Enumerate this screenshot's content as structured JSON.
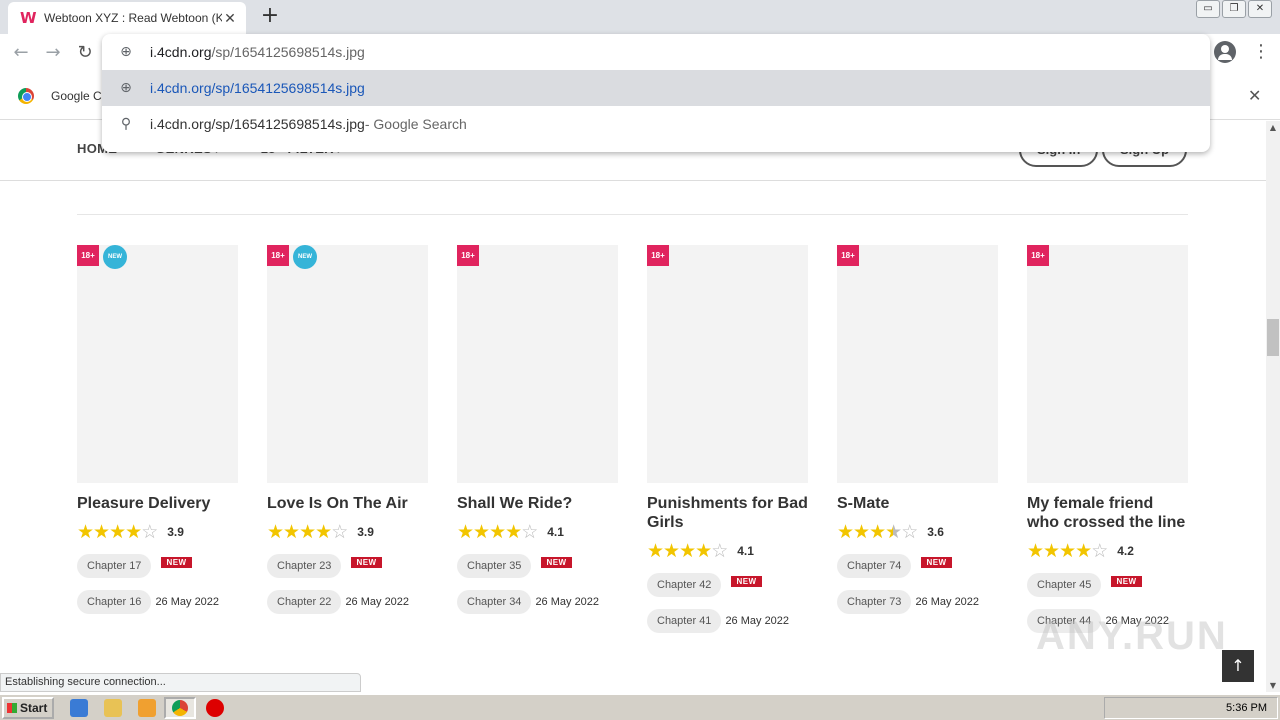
{
  "browser": {
    "tab_title": "Webtoon XYZ : Read Webtoon (Kore",
    "tab_favicon": "W",
    "tab_close": "✕",
    "new_tab": "+",
    "back_icon": "←",
    "forward_icon": "→",
    "reload_icon": "↻",
    "window_buttons": [
      "▭",
      "❐",
      "✕"
    ],
    "menu_icon": "⋮",
    "bookmark_label": "Google Chrome",
    "bookmark_close": "✕"
  },
  "omnibox": {
    "input_host": "i.4cdn.org",
    "input_path": "/sp/1654125698514s.jpg",
    "selected_suggestion": "i.4cdn.org/sp/1654125698514s.jpg",
    "search_suggestion": "i.4cdn.org/sp/1654125698514s.jpg",
    "search_suffix": " - Google Search"
  },
  "site": {
    "nav": [
      "HOME",
      "GENRES ▸",
      "18+ FILTER ▸"
    ],
    "sign_in": "Sign In",
    "sign_up": "Sign Up"
  },
  "cards": [
    {
      "title": "Pleasure Delivery",
      "stars": 3.9,
      "rating": "3.9",
      "new_badge": "NEW",
      "chapters": [
        {
          "label": "Chapter 17",
          "extra": "NEW"
        },
        {
          "label": "Chapter 16",
          "extra": "26 May 2022"
        }
      ]
    },
    {
      "title": "Love Is On The Air",
      "stars": 3.9,
      "rating": "3.9",
      "new_badge": "NEW",
      "chapters": [
        {
          "label": "Chapter 23",
          "extra": "NEW"
        },
        {
          "label": "Chapter 22",
          "extra": "26 May 2022"
        }
      ]
    },
    {
      "title": "Shall We Ride?",
      "stars": 4.1,
      "rating": "4.1",
      "new_badge": "",
      "chapters": [
        {
          "label": "Chapter 35",
          "extra": "NEW"
        },
        {
          "label": "Chapter 34",
          "extra": "26 May 2022"
        }
      ]
    },
    {
      "title": "Punishments for Bad Girls",
      "stars": 4.1,
      "rating": "4.1",
      "new_badge": "",
      "chapters": [
        {
          "label": "Chapter 42",
          "extra": "NEW"
        },
        {
          "label": "Chapter 41",
          "extra": "26 May 2022"
        }
      ]
    },
    {
      "title": "S-Mate",
      "stars": 3.6,
      "rating": "3.6",
      "new_badge": "",
      "chapters": [
        {
          "label": "Chapter 74",
          "extra": "NEW"
        },
        {
          "label": "Chapter 73",
          "extra": "26 May 2022"
        }
      ]
    },
    {
      "title": "My female friend who crossed the line",
      "stars": 4.2,
      "rating": "4.2",
      "new_badge": "",
      "chapters": [
        {
          "label": "Chapter 45",
          "extra": "NEW"
        },
        {
          "label": "Chapter 44",
          "extra": "26 May 2022"
        }
      ]
    }
  ],
  "badge_18": "18+",
  "back_to_top": "↑",
  "watermark": "ANY.RUN",
  "status": "Establishing secure connection...",
  "taskbar": {
    "start": "Start",
    "clock": "5:36 PM"
  },
  "colors": {
    "accent": "#e0245e",
    "star": "#f2c500",
    "new_tag": "#c7162b",
    "new_circle": "#35b4d8"
  }
}
